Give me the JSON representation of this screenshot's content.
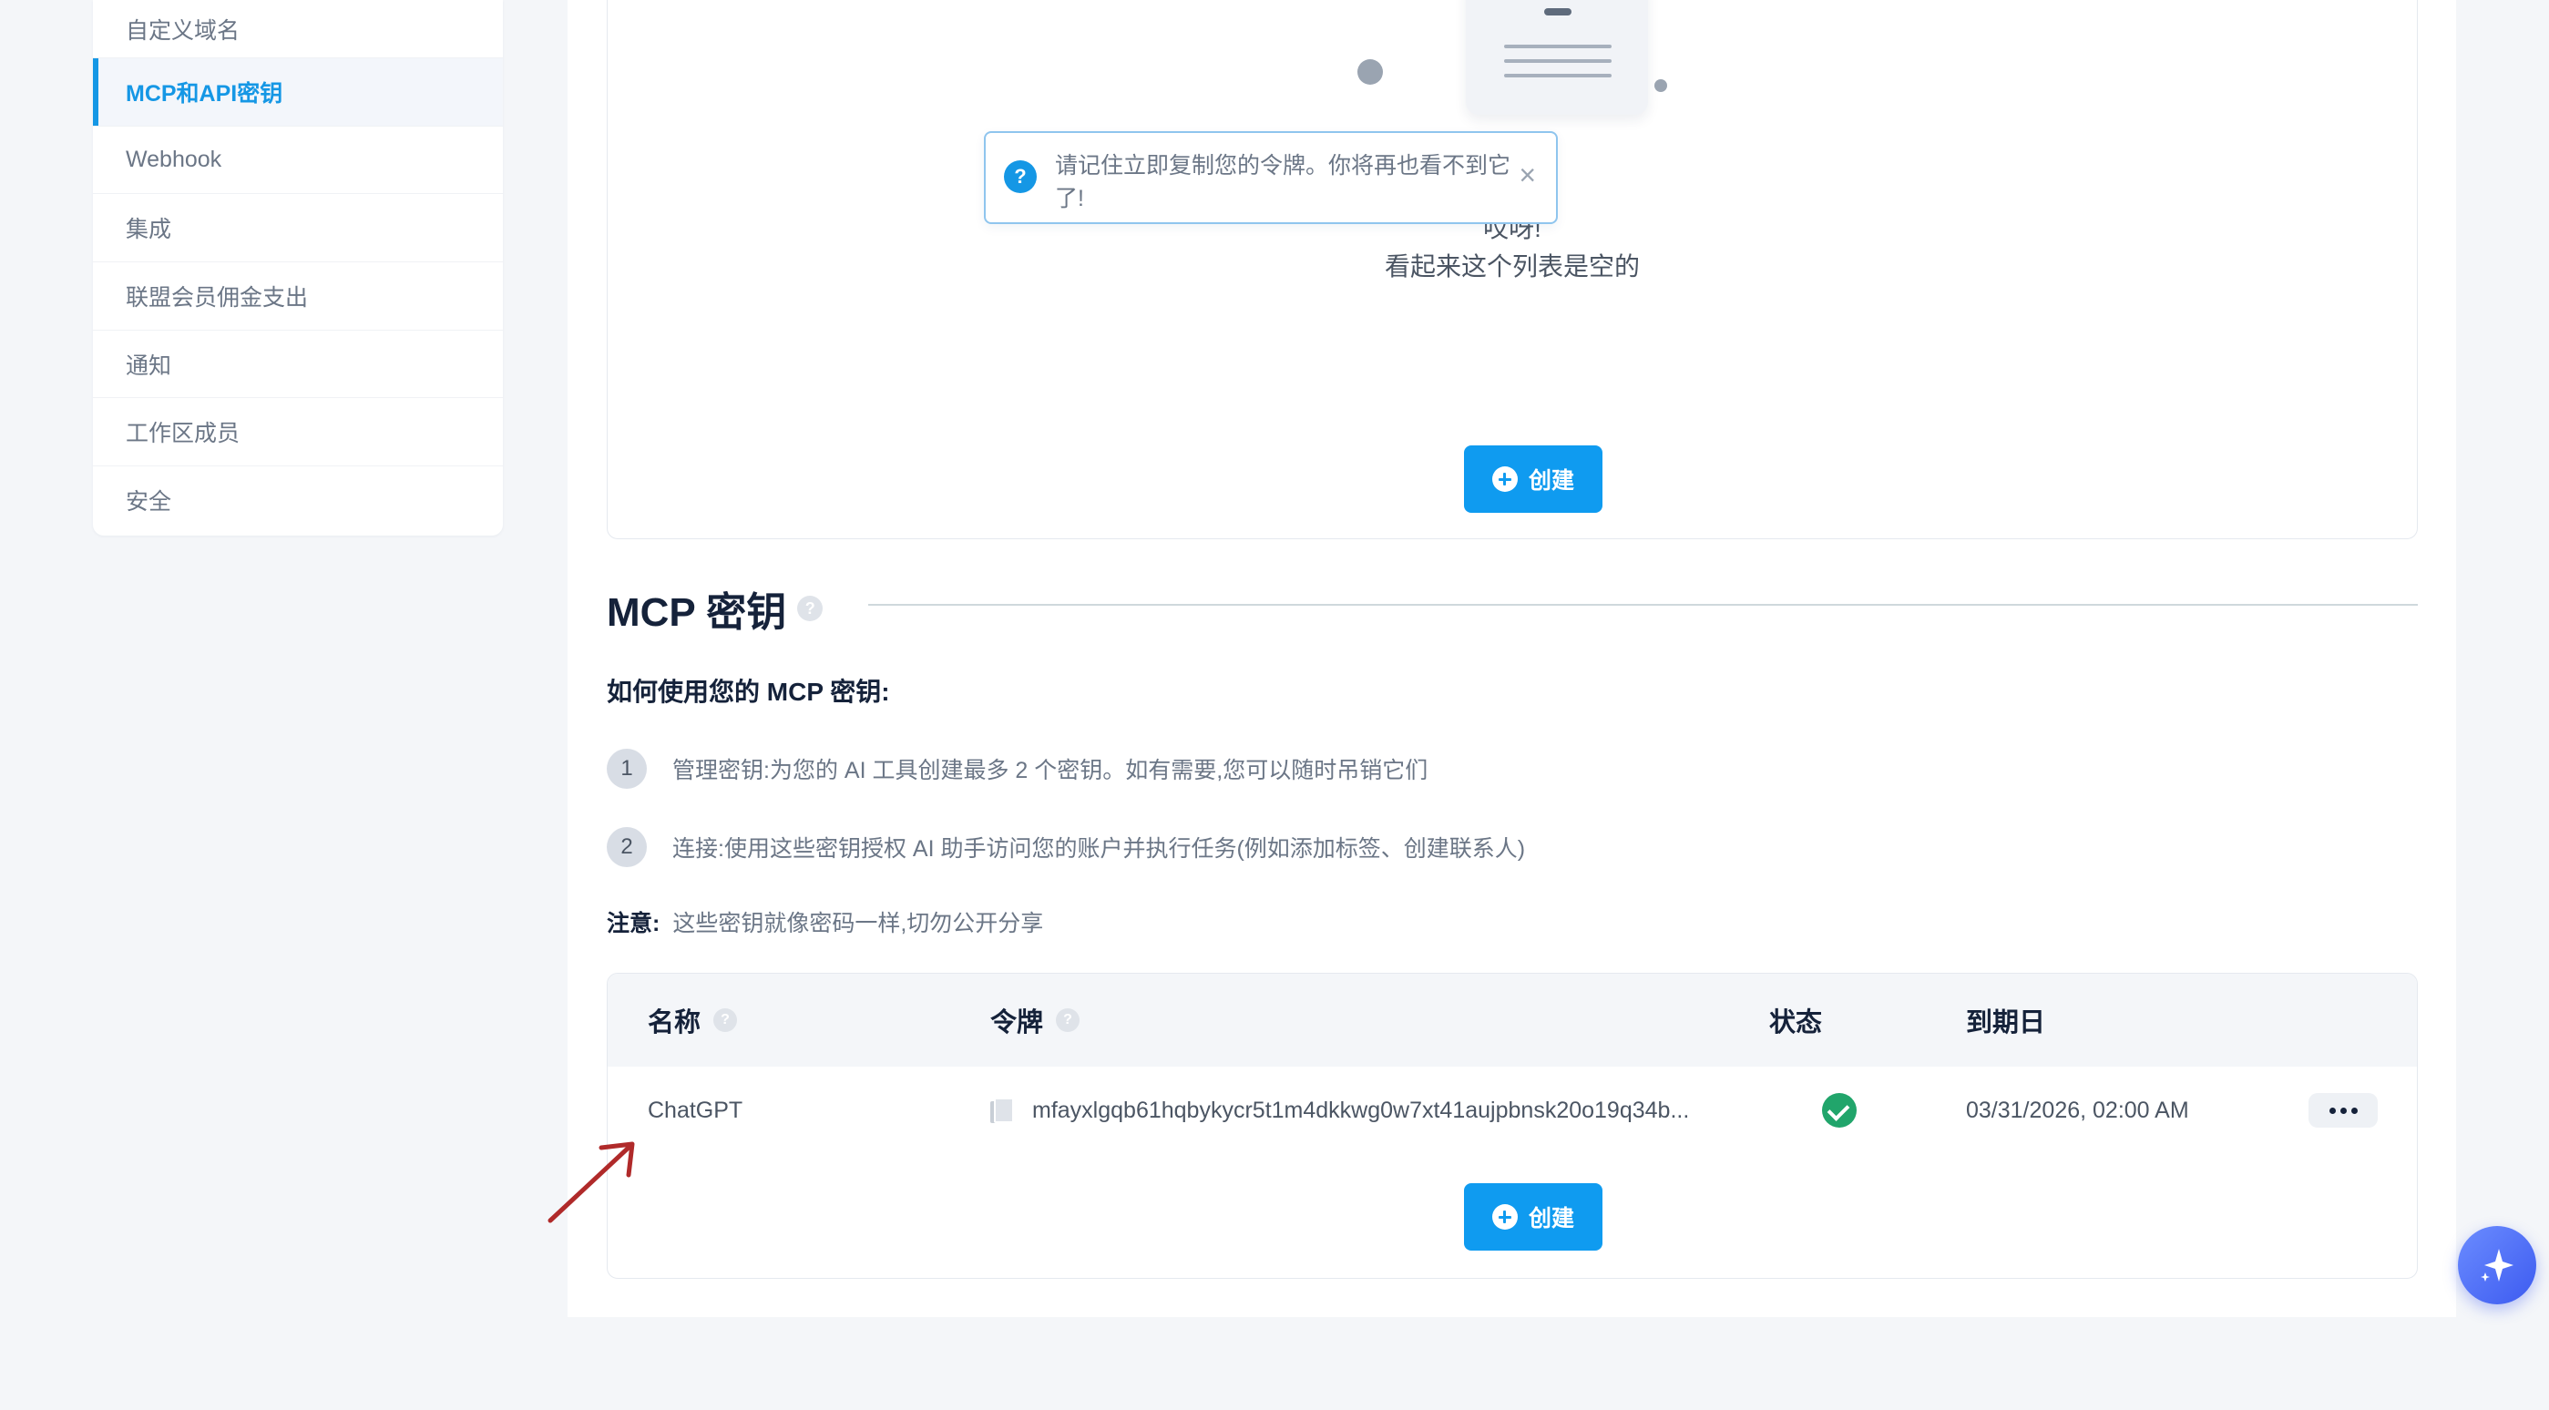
{
  "sidebar": {
    "items": [
      {
        "label": "自定义域名"
      },
      {
        "label": "MCP和API密钥",
        "active": true
      },
      {
        "label": "Webhook"
      },
      {
        "label": "集成"
      },
      {
        "label": "联盟会员佣金支出"
      },
      {
        "label": "通知"
      },
      {
        "label": "工作区成员"
      },
      {
        "label": "安全"
      }
    ]
  },
  "api_section": {
    "empty_title": "哎呀!",
    "empty_subtitle": "看起来这个列表是空的",
    "create_label": "创建"
  },
  "toast": {
    "message": "请记住立即复制您的令牌。你将再也看不到它了!",
    "icon": "question-icon",
    "close_symbol": "×"
  },
  "mcp_section": {
    "title": "MCP 密钥",
    "how_to_title": "如何使用您的 MCP 密钥:",
    "steps": [
      {
        "num": "1",
        "text": "管理密钥:为您的 AI 工具创建最多 2 个密钥。如有需要,您可以随时吊销它们"
      },
      {
        "num": "2",
        "text": "连接:使用这些密钥授权 AI 助手访问您的账户并执行任务(例如添加标签、创建联系人)"
      }
    ],
    "note_label": "注意:",
    "note_text": "这些密钥就像密码一样,切勿公开分享",
    "create_label": "创建"
  },
  "table": {
    "columns": {
      "name": "名称",
      "token": "令牌",
      "status": "状态",
      "expiry": "到期日"
    },
    "rows": [
      {
        "name": "ChatGPT",
        "token": "mfayxlgqb61hqbykycr5t1m4dkkwg0w7xt41aujpbnsk20o19q34b...",
        "status": "active",
        "expiry": "03/31/2026, 02:00 AM"
      }
    ]
  },
  "colors": {
    "accent": "#0f9bf0",
    "success": "#21a56b",
    "annotation_arrow": "#b02a2a"
  }
}
